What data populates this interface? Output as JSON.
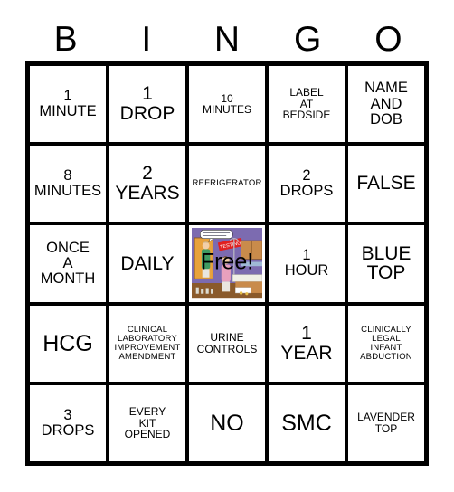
{
  "card": {
    "title": "BINGO",
    "header_letters": [
      "B",
      "I",
      "N",
      "G",
      "O"
    ],
    "grid_size": "5x5",
    "border_color": "#000000",
    "cell_background": "#ffffff",
    "text_color": "#000000"
  },
  "cells": [
    {
      "text": "1\nMINUTE",
      "size": "md",
      "type": "text"
    },
    {
      "text": "1\nDROP",
      "size": "lg",
      "type": "text"
    },
    {
      "text": "10\nMINUTES",
      "size": "sm",
      "type": "text"
    },
    {
      "text": "LABEL\nAT\nBEDSIDE",
      "size": "sm",
      "type": "text"
    },
    {
      "text": "NAME\nAND\nDOB",
      "size": "md",
      "type": "text"
    },
    {
      "text": "8\nMINUTES",
      "size": "md",
      "type": "text"
    },
    {
      "text": "2\nYEARS",
      "size": "lg",
      "type": "text"
    },
    {
      "text": "REFRIGERATOR",
      "size": "xs",
      "type": "text"
    },
    {
      "text": "2\nDROPS",
      "size": "md",
      "type": "text"
    },
    {
      "text": "FALSE",
      "size": "lg",
      "type": "text"
    },
    {
      "text": "ONCE\nA\nMONTH",
      "size": "md",
      "type": "text"
    },
    {
      "text": "DAILY",
      "size": "lg",
      "type": "text"
    },
    {
      "text": "Free!",
      "size": "lg",
      "type": "free"
    },
    {
      "text": "1\nHOUR",
      "size": "md",
      "type": "text"
    },
    {
      "text": "BLUE\nTOP",
      "size": "lg",
      "type": "text"
    },
    {
      "text": "HCG",
      "size": "xl",
      "type": "text"
    },
    {
      "text": "CLINICAL\nLABORATORY\nIMPROVEMENT\nAMENDMENT",
      "size": "xs",
      "type": "text"
    },
    {
      "text": "URINE\nCONTROLS",
      "size": "sm",
      "type": "text"
    },
    {
      "text": "1\nYEAR",
      "size": "lg",
      "type": "text"
    },
    {
      "text": "CLINICALLY\nLEGAL\nINFANT\nABDUCTION",
      "size": "xs",
      "type": "text"
    },
    {
      "text": "3\nDROPS",
      "size": "md",
      "type": "text"
    },
    {
      "text": "EVERY\nKIT\nOPENED",
      "size": "sm",
      "type": "text"
    },
    {
      "text": "NO",
      "size": "xl",
      "type": "text"
    },
    {
      "text": "SMC",
      "size": "xl",
      "type": "text"
    },
    {
      "text": "LAVENDER\nTOP",
      "size": "sm",
      "type": "text"
    }
  ],
  "free_space": {
    "label": "Free!",
    "artwork_name": "laboratory-cartoon-illustration",
    "colors": {
      "wall": "#7c6bb0",
      "door": "#e8a23c",
      "banner": "#e02020",
      "counter": "#f0efe6",
      "cabinet": "#c98b4b",
      "floor": "#8a5a2b",
      "scrub_green": "#3f9b62",
      "scrub_pink": "#e8a0bd"
    },
    "banner_text": "TESTING"
  }
}
